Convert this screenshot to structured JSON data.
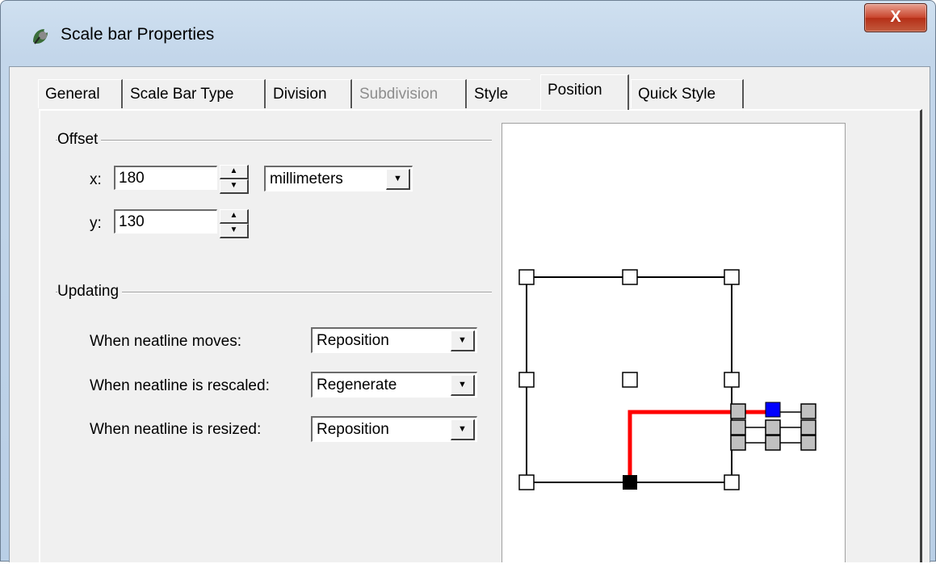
{
  "window": {
    "title": "Scale bar Properties",
    "close_label": "X"
  },
  "tabs": [
    {
      "label": "General",
      "state": "normal"
    },
    {
      "label": "Scale Bar Type",
      "state": "normal"
    },
    {
      "label": "Division",
      "state": "normal"
    },
    {
      "label": "Subdivision",
      "state": "disabled"
    },
    {
      "label": "Style",
      "state": "normal"
    },
    {
      "label": "Position",
      "state": "active"
    },
    {
      "label": "Quick Style",
      "state": "normal"
    }
  ],
  "offset": {
    "group_label": "Offset",
    "x_label": "x:",
    "x_value": "180",
    "y_label": "y:",
    "y_value": "130",
    "units": "millimeters"
  },
  "updating": {
    "group_label": "Updating",
    "rows": [
      {
        "label": "When neatline moves:",
        "value": "Reposition"
      },
      {
        "label": "When neatline is rescaled:",
        "value": "Regenerate"
      },
      {
        "label": "When neatline is resized:",
        "value": "Reposition"
      }
    ]
  },
  "colors": {
    "anchor_line": "#ff0000",
    "selected_anchor": "#0000ff",
    "scalebar_handle": "#c0c0c0"
  }
}
